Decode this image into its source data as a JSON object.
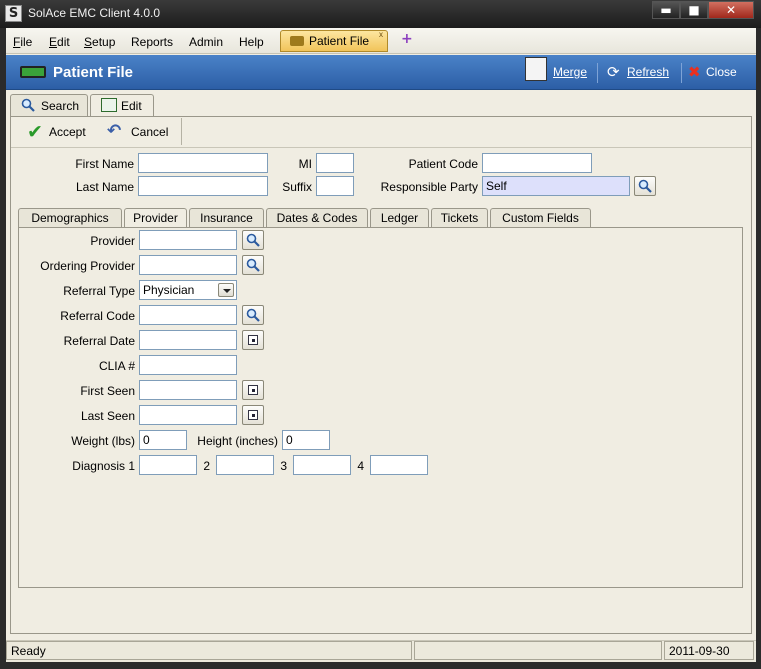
{
  "window": {
    "title": "SolAce EMC Client 4.0.0",
    "app_icon_letter": "S",
    "min": "▬",
    "max": "■",
    "close": "✕"
  },
  "menu": [
    {
      "key": "F",
      "rest": "ile"
    },
    {
      "key": "E",
      "rest": "dit"
    },
    {
      "key": "S",
      "rest": "etup"
    },
    {
      "key": "",
      "rest": "Reports"
    },
    {
      "key": "",
      "rest": "Admin"
    },
    {
      "key": "",
      "rest": "Help"
    }
  ],
  "doc_tab": {
    "label": "Patient File",
    "close": "x",
    "new": "+"
  },
  "header": {
    "title": "Patient File",
    "merge": "Merge",
    "refresh": "Refresh",
    "close": "Close"
  },
  "main_tabs": {
    "search": "Search",
    "edit": "Edit"
  },
  "toolbar": {
    "accept": "Accept",
    "cancel": "Cancel"
  },
  "patient": {
    "first_name_label": "First Name",
    "first_name": "",
    "mi_label": "MI",
    "mi": "",
    "patient_code_label": "Patient Code",
    "patient_code": "",
    "last_name_label": "Last Name",
    "last_name": "",
    "suffix_label": "Suffix",
    "suffix": "",
    "responsible_party_label": "Responsible Party",
    "responsible_party": "Self"
  },
  "sub_tabs": [
    "Demographics",
    "Provider",
    "Insurance",
    "Dates & Codes",
    "Ledger",
    "Tickets",
    "Custom Fields"
  ],
  "active_sub_tab": "Provider",
  "provider": {
    "provider_label": "Provider",
    "provider": "",
    "ordering_provider_label": "Ordering Provider",
    "ordering_provider": "",
    "referral_type_label": "Referral Type",
    "referral_type": "Physician",
    "referral_code_label": "Referral Code",
    "referral_code": "",
    "referral_date_label": "Referral Date",
    "referral_date": "",
    "clia_label": "CLIA #",
    "clia": "",
    "first_seen_label": "First Seen",
    "first_seen": "",
    "last_seen_label": "Last Seen",
    "last_seen": "",
    "weight_label": "Weight (lbs)",
    "weight": "0",
    "height_label": "Height (inches)",
    "height": "0",
    "diagnosis_label": "Diagnosis 1",
    "diag_labels": [
      "2",
      "3",
      "4"
    ],
    "diagnosis": [
      "",
      "",
      "",
      ""
    ]
  },
  "status": {
    "text": "Ready",
    "date": "2011-09-30"
  }
}
